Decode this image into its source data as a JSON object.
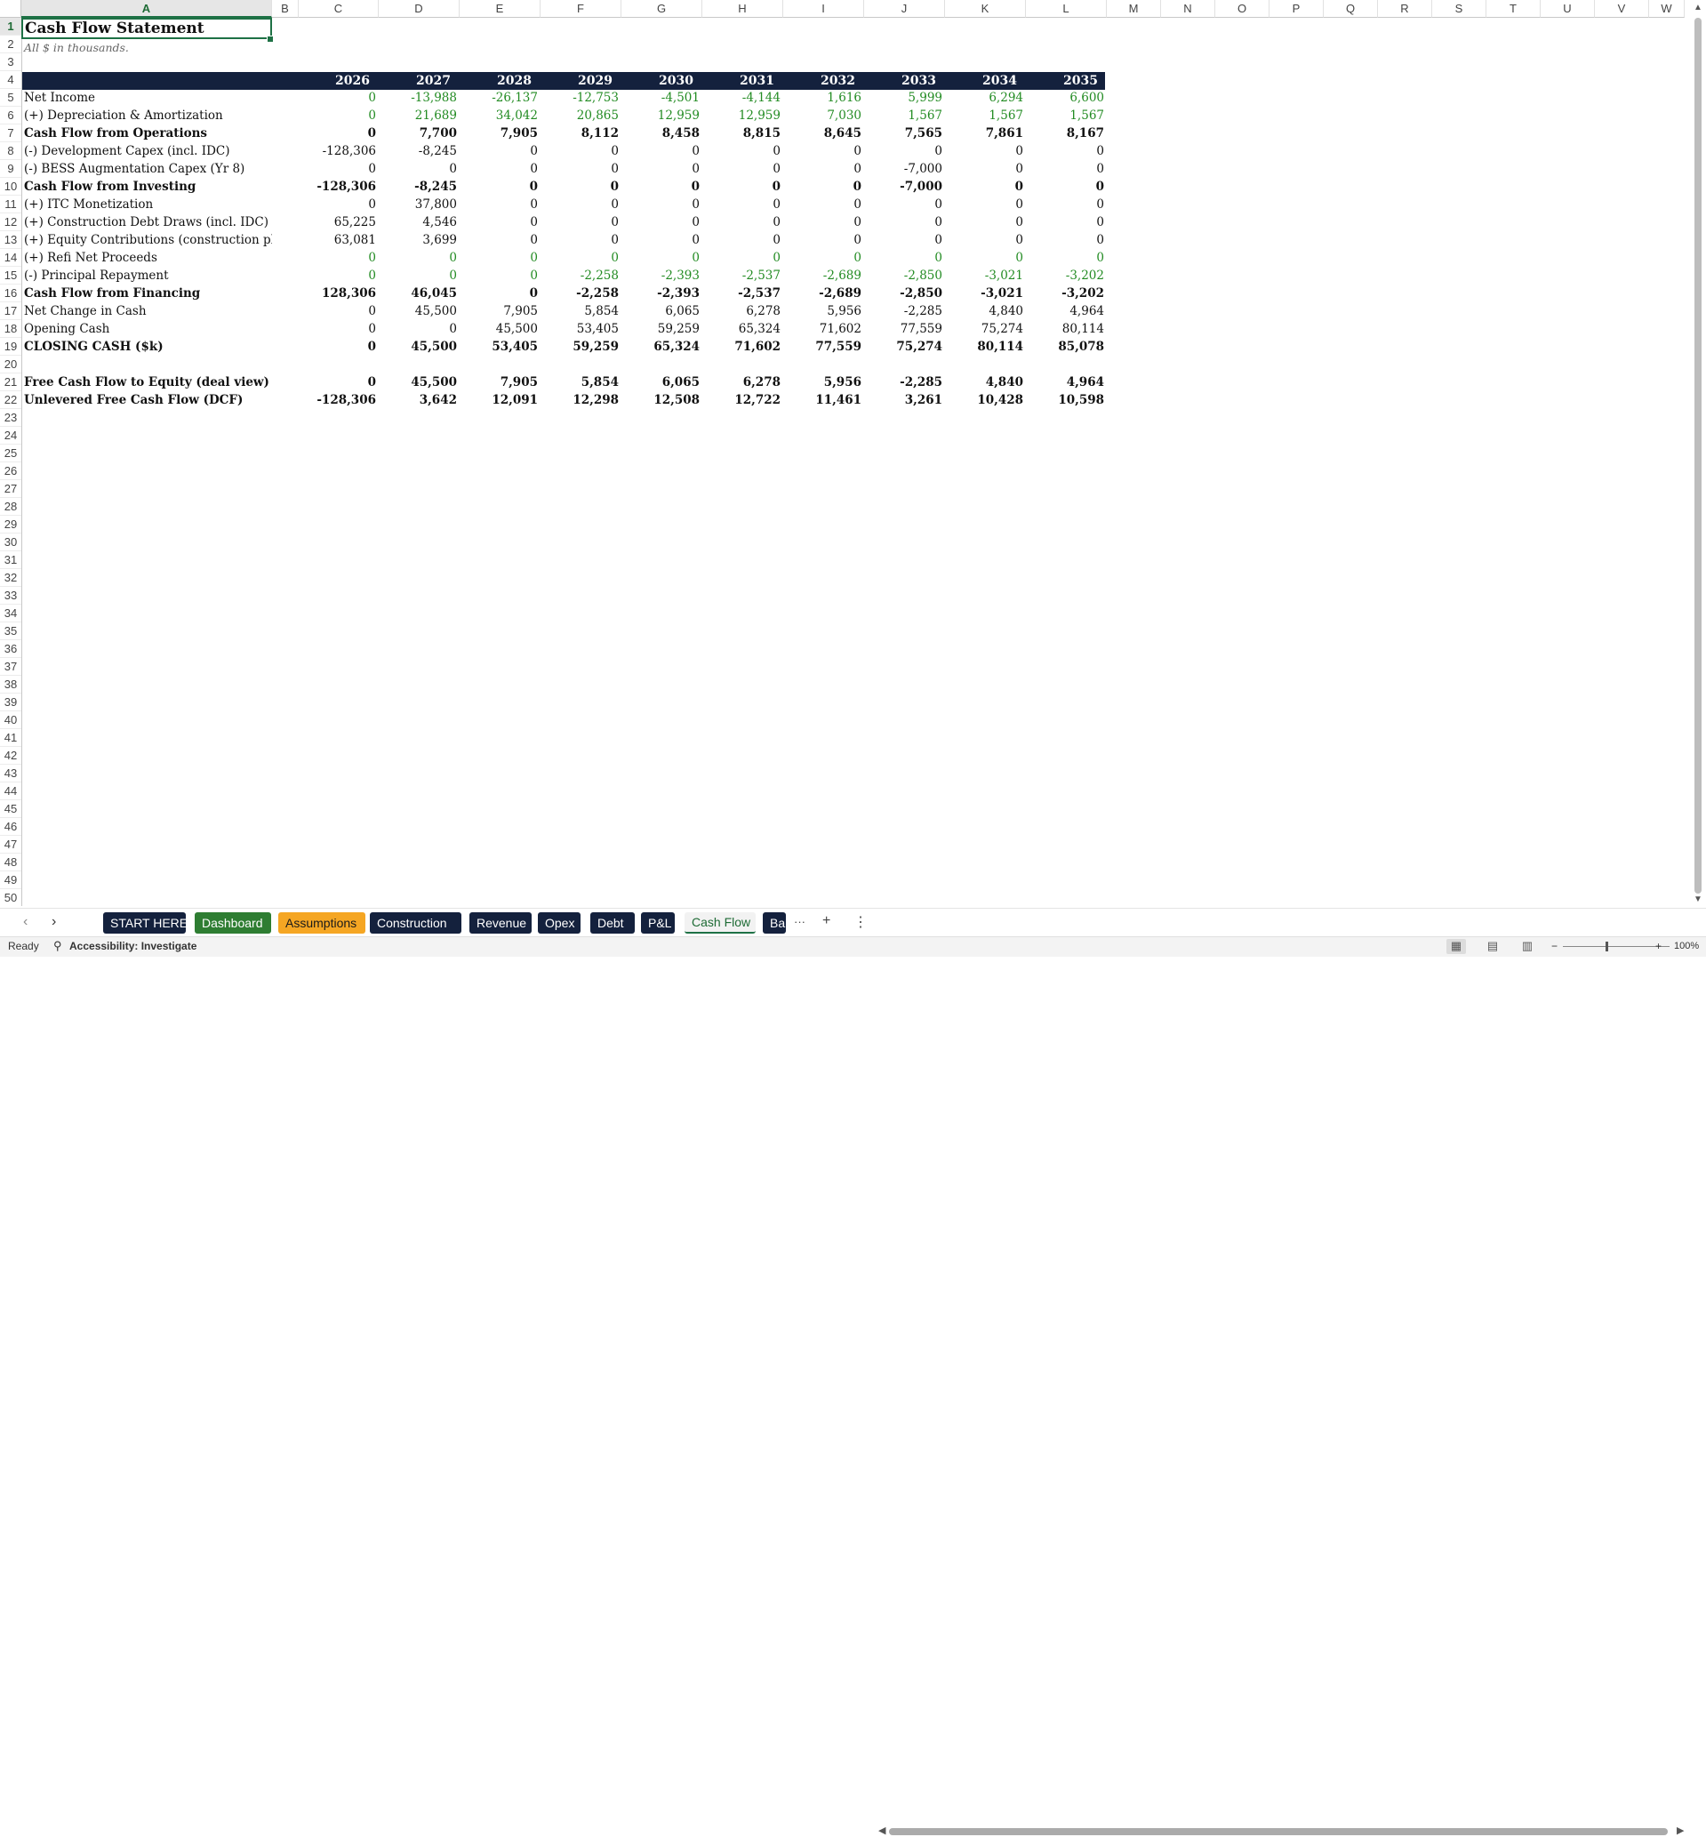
{
  "sheet": {
    "columns": [
      "A",
      "B",
      "C",
      "D",
      "E",
      "F",
      "G",
      "H",
      "I",
      "J",
      "K",
      "L",
      "M",
      "N",
      "O",
      "P",
      "Q",
      "R",
      "S",
      "T",
      "U",
      "V",
      "W"
    ],
    "selected_column": "A",
    "row_numbers": [
      "1",
      "2",
      "3",
      "4",
      "5",
      "6",
      "7",
      "8",
      "9",
      "10",
      "11",
      "12",
      "13",
      "14",
      "15",
      "16",
      "17",
      "18",
      "19",
      "20",
      "21",
      "22",
      "23",
      "24",
      "25",
      "26",
      "27",
      "28",
      "29",
      "30",
      "31",
      "32",
      "33",
      "34",
      "35",
      "36",
      "37",
      "38",
      "39",
      "40",
      "41",
      "42",
      "43",
      "44",
      "45",
      "46",
      "47",
      "48",
      "49",
      "50"
    ],
    "selected_row": "1",
    "title": "Cash Flow Statement",
    "subtitle": "All $ in thousands.",
    "years": [
      "2026",
      "2027",
      "2028",
      "2029",
      "2030",
      "2031",
      "2032",
      "2033",
      "2034",
      "2035"
    ],
    "rows": [
      {
        "row": "5",
        "label": "Net Income",
        "bold": false,
        "green": true,
        "values": [
          "0",
          "-13,988",
          "-26,137",
          "-12,753",
          "-4,501",
          "-4,144",
          "1,616",
          "5,999",
          "6,294",
          "6,600"
        ]
      },
      {
        "row": "6",
        "label": "(+) Depreciation & Amortization",
        "bold": false,
        "green": true,
        "values": [
          "0",
          "21,689",
          "34,042",
          "20,865",
          "12,959",
          "12,959",
          "7,030",
          "1,567",
          "1,567",
          "1,567"
        ]
      },
      {
        "row": "7",
        "label": "Cash Flow from Operations",
        "bold": true,
        "green": false,
        "values": [
          "0",
          "7,700",
          "7,905",
          "8,112",
          "8,458",
          "8,815",
          "8,645",
          "7,565",
          "7,861",
          "8,167"
        ]
      },
      {
        "row": "8",
        "label": "(-) Development Capex (incl. IDC)",
        "bold": false,
        "green": false,
        "values": [
          "-128,306",
          "-8,245",
          "0",
          "0",
          "0",
          "0",
          "0",
          "0",
          "0",
          "0"
        ]
      },
      {
        "row": "9",
        "label": "(-) BESS Augmentation Capex (Yr 8)",
        "bold": false,
        "green": false,
        "values": [
          "0",
          "0",
          "0",
          "0",
          "0",
          "0",
          "0",
          "-7,000",
          "0",
          "0"
        ]
      },
      {
        "row": "10",
        "label": "Cash Flow from Investing",
        "bold": true,
        "green": false,
        "values": [
          "-128,306",
          "-8,245",
          "0",
          "0",
          "0",
          "0",
          "0",
          "-7,000",
          "0",
          "0"
        ]
      },
      {
        "row": "11",
        "label": "(+) ITC Monetization",
        "bold": false,
        "green": false,
        "values": [
          "0",
          "37,800",
          "0",
          "0",
          "0",
          "0",
          "0",
          "0",
          "0",
          "0"
        ]
      },
      {
        "row": "12",
        "label": "(+) Construction Debt Draws (incl. IDC)",
        "bold": false,
        "green": false,
        "values": [
          "65,225",
          "4,546",
          "0",
          "0",
          "0",
          "0",
          "0",
          "0",
          "0",
          "0"
        ]
      },
      {
        "row": "13",
        "label": "(+) Equity Contributions (construction phase onl",
        "bold": false,
        "green": false,
        "values": [
          "63,081",
          "3,699",
          "0",
          "0",
          "0",
          "0",
          "0",
          "0",
          "0",
          "0"
        ]
      },
      {
        "row": "14",
        "label": "(+) Refi Net Proceeds",
        "bold": false,
        "green": true,
        "values": [
          "0",
          "0",
          "0",
          "0",
          "0",
          "0",
          "0",
          "0",
          "0",
          "0"
        ]
      },
      {
        "row": "15",
        "label": "(-) Principal Repayment",
        "bold": false,
        "green": true,
        "values": [
          "0",
          "0",
          "0",
          "-2,258",
          "-2,393",
          "-2,537",
          "-2,689",
          "-2,850",
          "-3,021",
          "-3,202"
        ]
      },
      {
        "row": "16",
        "label": "Cash Flow from Financing",
        "bold": true,
        "green": false,
        "values": [
          "128,306",
          "46,045",
          "0",
          "-2,258",
          "-2,393",
          "-2,537",
          "-2,689",
          "-2,850",
          "-3,021",
          "-3,202"
        ]
      },
      {
        "row": "17",
        "label": "Net Change in Cash",
        "bold": false,
        "green": false,
        "values": [
          "0",
          "45,500",
          "7,905",
          "5,854",
          "6,065",
          "6,278",
          "5,956",
          "-2,285",
          "4,840",
          "4,964"
        ]
      },
      {
        "row": "18",
        "label": "Opening Cash",
        "bold": false,
        "green": false,
        "values": [
          "0",
          "0",
          "45,500",
          "53,405",
          "59,259",
          "65,324",
          "71,602",
          "77,559",
          "75,274",
          "80,114"
        ]
      },
      {
        "row": "19",
        "label": "CLOSING CASH ($k)",
        "bold": true,
        "green": false,
        "values": [
          "0",
          "45,500",
          "53,405",
          "59,259",
          "65,324",
          "71,602",
          "77,559",
          "75,274",
          "80,114",
          "85,078"
        ]
      },
      {
        "row": "21",
        "label": "Free Cash Flow to Equity (deal view)",
        "bold": true,
        "green": false,
        "values": [
          "0",
          "45,500",
          "7,905",
          "5,854",
          "6,065",
          "6,278",
          "5,956",
          "-2,285",
          "4,840",
          "4,964"
        ]
      },
      {
        "row": "22",
        "label": "Unlevered Free Cash Flow (DCF)",
        "bold": true,
        "green": false,
        "values": [
          "-128,306",
          "3,642",
          "12,091",
          "12,298",
          "12,508",
          "12,722",
          "11,461",
          "3,261",
          "10,428",
          "10,598"
        ]
      }
    ]
  },
  "tabs": [
    {
      "label": "START HERE",
      "color": "#14213d",
      "active": false
    },
    {
      "label": "Dashboard",
      "color": "#2e7d32",
      "active": false
    },
    {
      "label": "Assumptions",
      "color": "#f5a623",
      "active": false
    },
    {
      "label": "Construction",
      "color": "#14213d",
      "active": false
    },
    {
      "label": "Revenue",
      "color": "#14213d",
      "active": false
    },
    {
      "label": "Opex",
      "color": "#14213d",
      "active": false
    },
    {
      "label": "Debt",
      "color": "#14213d",
      "active": false
    },
    {
      "label": "P&L",
      "color": "#14213d",
      "active": false
    },
    {
      "label": "Cash Flow",
      "color": "#f2f2f2",
      "active": true
    },
    {
      "label": "Ba",
      "color": "#14213d",
      "active": false
    }
  ],
  "tabbar": {
    "more": "···",
    "add": "+",
    "options": "⋮"
  },
  "status": {
    "ready": "Ready",
    "accessibility": "Accessibility: Investigate",
    "zoom": "100%",
    "zoom_minus": "−",
    "zoom_plus": "+"
  },
  "colors": {
    "header_band": "#14213d",
    "green_text": "#228b22",
    "selection": "#1e7145"
  }
}
